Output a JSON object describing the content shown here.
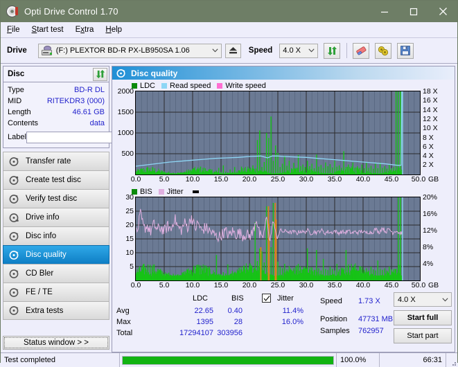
{
  "window": {
    "title": "Opti Drive Control 1.70",
    "icon": "disc-icon",
    "minimize": "minimize",
    "maximize": "maximize",
    "close": "close"
  },
  "menu": [
    {
      "label": "File",
      "accel": "F"
    },
    {
      "label": "Start test",
      "accel": "S"
    },
    {
      "label": "Extra",
      "accel": "x"
    },
    {
      "label": "Help",
      "accel": "H"
    }
  ],
  "toolbar": {
    "drive_label": "Drive",
    "drive_value": "(F:)   PLEXTOR BD-R  PX-LB950SA 1.06",
    "eject_icon": "eject-icon",
    "speed_label": "Speed",
    "speed_value": "4.0 X",
    "refresh_icon": "refresh-icon",
    "erase_icon": "eraser-icon",
    "settings_icon": "gear-icon",
    "save_icon": "floppy-save-icon"
  },
  "disc_panel": {
    "title": "Disc",
    "refresh_icon": "refresh-icon",
    "rows": [
      {
        "key": "Type",
        "value": "BD-R DL"
      },
      {
        "key": "MID",
        "value": "RITEKDR3 (000)"
      },
      {
        "key": "Length",
        "value": "46.61 GB"
      },
      {
        "key": "Contents",
        "value": "data"
      }
    ],
    "label_key": "Label",
    "label_value": "",
    "label_placeholder": "",
    "label_button_icon": "disc-icon"
  },
  "nav": {
    "items": [
      {
        "label": "Transfer rate",
        "icon": "disc-speed-icon",
        "selected": false
      },
      {
        "label": "Create test disc",
        "icon": "disc-burn-icon",
        "selected": false
      },
      {
        "label": "Verify test disc",
        "icon": "disc-check-icon",
        "selected": false
      },
      {
        "label": "Drive info",
        "icon": "disc-info-icon",
        "selected": false
      },
      {
        "label": "Disc info",
        "icon": "disc-info-icon",
        "selected": false
      },
      {
        "label": "Disc quality",
        "icon": "disc-quality-icon",
        "selected": true
      },
      {
        "label": "CD Bler",
        "icon": "disc-bler-icon",
        "selected": false
      },
      {
        "label": "FE / TE",
        "icon": "disc-fete-icon",
        "selected": false
      },
      {
        "label": "Extra tests",
        "icon": "disc-extra-icon",
        "selected": false
      }
    ],
    "status_window_button": "Status window > >"
  },
  "main": {
    "header_title": "Disc quality",
    "header_icon": "disc-quality-icon"
  },
  "stats": {
    "col_ldc": "LDC",
    "col_bis": "BIS",
    "jitter_label": "Jitter",
    "jitter_checked": true,
    "rows": [
      {
        "name": "Avg",
        "ldc": "22.65",
        "bis": "0.40",
        "jitter": "11.4%"
      },
      {
        "name": "Max",
        "ldc": "1395",
        "bis": "28",
        "jitter": "16.0%"
      },
      {
        "name": "Total",
        "ldc": "17294107",
        "bis": "303956",
        "jitter": ""
      }
    ],
    "speed_label": "Speed",
    "speed_value": "1.73 X",
    "position_label": "Position",
    "position_value": "47731 MB",
    "samples_label": "Samples",
    "samples_value": "762957",
    "speed_select": "4.0 X",
    "start_full": "Start full",
    "start_part": "Start part"
  },
  "statusbar": {
    "message": "Test completed",
    "progress_percent": "100.0%",
    "progress_value": 100,
    "elapsed": "66:31"
  },
  "colors": {
    "ldc": "#16c316",
    "bis": "#16c316",
    "read_speed": "#8ed6f5",
    "write_speed": "#ff6ed2",
    "jitter": "#e0b0e0",
    "plot_bg": "#6b7a94",
    "accent": "#1f8fd6",
    "title_bar": "#6e7e66",
    "value_text": "#2222cc",
    "progress": "#12b312"
  },
  "chart_data": [
    {
      "type": "area",
      "title": "Disc quality - LDC / Read speed",
      "xlabel": "GB",
      "ylabel": "LDC",
      "xlim": [
        0.0,
        50.0
      ],
      "ylim": [
        0,
        2000
      ],
      "y2lim": [
        0,
        18
      ],
      "y2label": "X",
      "grid": true,
      "legend_position": "top-left",
      "xticks": [
        "0.0",
        "5.0",
        "10.0",
        "15.0",
        "20.0",
        "25.0",
        "30.0",
        "35.0",
        "40.0",
        "45.0",
        "50.0"
      ],
      "yticks": [
        500,
        1000,
        1500,
        2000
      ],
      "y2ticks": [
        "2 X",
        "4 X",
        "6 X",
        "8 X",
        "10 X",
        "12 X",
        "14 X",
        "16 X",
        "18 X"
      ],
      "xunit": "GB",
      "legend": [
        {
          "name": "LDC",
          "color": "#16c316"
        },
        {
          "name": "Read speed",
          "color": "#8ed6f5"
        },
        {
          "name": "Write speed",
          "color": "#ff6ed2"
        }
      ],
      "series": [
        {
          "name": "LDC",
          "color": "#16c316",
          "kind": "impulse",
          "x": [
            0.2,
            0.6,
            1.0,
            1.4,
            1.8,
            2.2,
            2.6,
            3.0,
            3.4,
            3.8,
            4.2,
            4.6,
            5.0,
            5.4,
            5.8,
            6.2,
            6.6,
            7.0,
            7.4,
            7.8,
            8.2,
            8.6,
            9.0,
            9.4,
            9.8,
            10.2,
            10.6,
            11.0,
            11.4,
            11.8,
            12.2,
            12.6,
            13.0,
            13.4,
            13.8,
            14.2,
            14.6,
            15.0,
            15.4,
            15.8,
            16.2,
            16.6,
            17.0,
            17.4,
            17.8,
            18.2,
            18.6,
            19.0,
            19.4,
            19.8,
            20.2,
            20.6,
            21.0,
            21.4,
            21.8,
            22.2,
            22.6,
            23.0,
            23.4,
            23.8,
            24.2,
            24.6,
            25.0,
            25.4,
            25.8,
            26.2,
            26.6,
            27.0,
            27.4,
            27.8,
            28.2,
            28.6,
            29.0,
            29.4,
            29.8,
            30.2,
            30.6,
            31.0,
            31.4,
            31.8,
            32.2,
            32.6,
            33.0,
            33.4,
            33.8,
            34.2,
            34.6,
            35.0,
            35.4,
            35.8,
            36.2,
            36.6,
            37.0,
            37.4,
            37.8,
            38.2,
            38.6,
            39.0,
            39.4,
            39.8,
            40.2,
            40.6,
            41.0,
            41.4,
            41.8,
            42.2,
            42.6,
            43.0,
            43.4,
            43.8,
            44.2,
            44.6,
            45.0,
            45.4,
            45.8,
            46.2,
            46.6
          ],
          "y": [
            40,
            35,
            60,
            30,
            45,
            80,
            35,
            50,
            30,
            60,
            40,
            35,
            55,
            30,
            70,
            35,
            45,
            30,
            50,
            40,
            35,
            60,
            30,
            45,
            35,
            150,
            70,
            50,
            190,
            60,
            45,
            80,
            55,
            120,
            70,
            95,
            160,
            60,
            220,
            70,
            50,
            120,
            60,
            180,
            70,
            55,
            190,
            80,
            60,
            140,
            70,
            220,
            75,
            830,
            1060,
            180,
            300,
            1000,
            880,
            1395,
            330,
            700,
            520,
            180,
            260,
            450,
            210,
            330,
            150,
            280,
            160,
            470,
            200,
            240,
            180,
            330,
            200,
            260,
            150,
            480,
            190,
            230,
            160,
            290,
            200,
            250,
            170,
            330,
            190,
            220,
            160,
            560,
            180,
            240,
            150,
            290,
            170,
            200,
            160,
            240,
            150,
            280,
            160,
            210,
            140,
            260,
            150,
            290,
            160,
            200,
            140,
            230,
            150,
            180
          ]
        },
        {
          "name": "Read speed",
          "color": "#8ed6f5",
          "kind": "line",
          "x": [
            0.0,
            2.0,
            4.0,
            6.0,
            8.0,
            10.0,
            12.0,
            14.0,
            16.0,
            18.0,
            20.0,
            22.0,
            23.2,
            24.0,
            25.0,
            26.0,
            28.0,
            30.0,
            32.0,
            34.0,
            36.0,
            38.0,
            40.0,
            42.0,
            44.0,
            46.0,
            46.7,
            46.8,
            47.0
          ],
          "y": [
            1.8,
            2.1,
            2.4,
            2.7,
            2.9,
            3.1,
            3.3,
            3.5,
            3.6,
            3.7,
            3.9,
            4.0,
            3.6,
            4.0,
            4.0,
            3.9,
            3.8,
            3.7,
            3.5,
            3.3,
            3.1,
            2.9,
            2.7,
            2.5,
            2.3,
            2.0,
            2.0,
            18.0,
            18.0
          ]
        }
      ]
    },
    {
      "type": "area",
      "title": "Disc quality - BIS / Jitter",
      "xlabel": "GB",
      "ylabel": "BIS",
      "xlim": [
        0.0,
        50.0
      ],
      "ylim": [
        0,
        30
      ],
      "y2lim": [
        0,
        20
      ],
      "y2label": "%",
      "grid": true,
      "legend_position": "top-left",
      "xticks": [
        "0.0",
        "5.0",
        "10.0",
        "15.0",
        "20.0",
        "25.0",
        "30.0",
        "35.0",
        "40.0",
        "45.0",
        "50.0"
      ],
      "yticks": [
        5,
        10,
        15,
        20,
        25,
        30
      ],
      "y2ticks": [
        "4%",
        "8%",
        "12%",
        "16%",
        "20%"
      ],
      "xunit": "GB",
      "legend": [
        {
          "name": "BIS",
          "color": "#16c316"
        },
        {
          "name": "Jitter",
          "color": "#e0b0e0"
        }
      ],
      "series": [
        {
          "name": "BIS",
          "color": "#16c316",
          "kind": "impulse",
          "x": [
            0.2,
            0.6,
            1.0,
            1.4,
            1.8,
            2.2,
            2.6,
            3.0,
            3.4,
            3.8,
            4.2,
            4.6,
            5.0,
            5.4,
            5.8,
            6.2,
            6.6,
            7.0,
            7.4,
            7.8,
            8.2,
            8.6,
            9.0,
            9.4,
            9.8,
            10.2,
            10.6,
            11.0,
            11.4,
            11.8,
            12.2,
            12.6,
            13.0,
            13.4,
            13.8,
            14.2,
            14.6,
            15.0,
            15.4,
            15.8,
            16.2,
            16.6,
            17.0,
            17.4,
            17.8,
            18.2,
            18.6,
            19.0,
            19.4,
            19.8,
            20.2,
            20.6,
            21.0,
            21.4,
            21.8,
            22.2,
            22.6,
            23.0,
            23.4,
            23.8,
            24.2,
            24.6,
            25.0,
            25.4,
            25.8,
            26.2,
            26.6,
            27.0,
            27.4,
            27.8,
            28.2,
            28.6,
            29.0,
            29.4,
            29.8,
            30.2,
            30.6,
            31.0,
            31.4,
            31.8,
            32.2,
            32.6,
            33.0,
            33.4,
            33.8,
            34.2,
            34.6,
            35.0,
            35.4,
            35.8,
            36.2,
            36.6,
            37.0,
            37.4,
            37.8,
            38.2,
            38.6,
            39.0,
            39.4,
            39.8,
            40.2,
            40.6,
            41.0,
            41.4,
            41.8,
            42.2,
            42.6,
            43.0,
            43.4,
            43.8,
            44.2,
            44.6,
            45.0,
            45.4,
            45.8,
            46.2,
            46.6
          ],
          "y": [
            2.2,
            2.0,
            2.4,
            1.9,
            2.1,
            2.3,
            2.0,
            2.5,
            1.9,
            2.2,
            2.6,
            2.0,
            2.3,
            1.9,
            2.8,
            2.0,
            2.4,
            2.1,
            2.2,
            2.0,
            2.6,
            2.1,
            4.0,
            2.2,
            2.5,
            5.0,
            2.3,
            4.6,
            2.4,
            2.2,
            2.8,
            2.0,
            3.0,
            2.3,
            2.6,
            9.2,
            2.4,
            2.2,
            3.0,
            2.5,
            5.8,
            2.3,
            3.4,
            2.6,
            2.8,
            4.6,
            2.4,
            3.0,
            2.6,
            3.2,
            5.0,
            2.8,
            21.0,
            7.0,
            11.5,
            10.5,
            6.5,
            26.8,
            13.0,
            12.0,
            28.0,
            9.0,
            6.8,
            5.0,
            4.4,
            6.0,
            4.0,
            5.2,
            3.8,
            4.4,
            3.6,
            6.0,
            4.2,
            3.8,
            5.0,
            11.6,
            4.0,
            4.6,
            3.8,
            11.0,
            4.4,
            3.6,
            7.8,
            4.2,
            3.8,
            5.0,
            4.2,
            3.6,
            6.0,
            4.0,
            4.6,
            3.8,
            11.0,
            4.4,
            3.6,
            4.8,
            4.0,
            3.6,
            5.2,
            4.0,
            3.8,
            4.4,
            3.6,
            5.0,
            4.0,
            3.6,
            7.2,
            4.2,
            3.8,
            4.4,
            3.6,
            5.0,
            4.0,
            3.6,
            4.2
          ]
        },
        {
          "name": "Jitter",
          "color": "#e0b0e0",
          "kind": "line",
          "unit": "%",
          "x": [
            0.2,
            0.8,
            1.4,
            2.0,
            2.6,
            3.2,
            3.8,
            4.4,
            5.0,
            5.6,
            6.2,
            6.8,
            7.4,
            8.0,
            8.6,
            9.2,
            9.8,
            10.4,
            11.0,
            11.6,
            12.2,
            12.8,
            13.4,
            14.0,
            14.6,
            15.2,
            15.8,
            16.4,
            17.0,
            17.6,
            18.2,
            18.8,
            19.4,
            20.0,
            20.6,
            21.2,
            21.8,
            22.4,
            23.0,
            23.6,
            24.2,
            24.8,
            25.4,
            26.0,
            26.6,
            27.2,
            27.8,
            28.4,
            29.0,
            29.6,
            30.2,
            30.8,
            31.4,
            32.0,
            32.6,
            33.2,
            33.8,
            34.4,
            35.0,
            35.6,
            36.2,
            36.8,
            37.4,
            38.0,
            38.6,
            39.2,
            39.8,
            40.4,
            41.0,
            41.6,
            42.2,
            42.8,
            43.4,
            44.0,
            44.6,
            45.2,
            45.8,
            46.4,
            46.8
          ],
          "y": [
            16.5,
            23.8,
            18.5,
            19.5,
            17.5,
            20.0,
            18.0,
            19.0,
            17.5,
            19.5,
            18.0,
            22.5,
            19.0,
            18.0,
            20.5,
            19.0,
            23.0,
            18.5,
            20.5,
            17.5,
            19.0,
            18.0,
            17.0,
            16.0,
            15.5,
            16.5,
            17.5,
            16.0,
            17.5,
            16.5,
            17.0,
            16.0,
            16.5,
            15.8,
            17.0,
            22.5,
            16.0,
            15.5,
            23.0,
            14.0,
            21.8,
            15.0,
            18.0,
            17.5,
            17.8,
            17.2,
            17.5,
            17.0,
            17.8,
            17.2,
            18.0,
            17.0,
            17.5,
            17.2,
            18.2,
            17.0,
            17.5,
            17.2,
            17.8,
            17.0,
            17.5,
            17.2,
            17.8,
            17.0,
            17.5,
            17.2,
            17.8,
            17.0,
            17.5,
            17.2,
            18.5,
            17.2,
            19.0,
            17.5,
            18.5,
            17.2,
            18.0,
            17.0,
            17.2
          ]
        }
      ]
    }
  ]
}
